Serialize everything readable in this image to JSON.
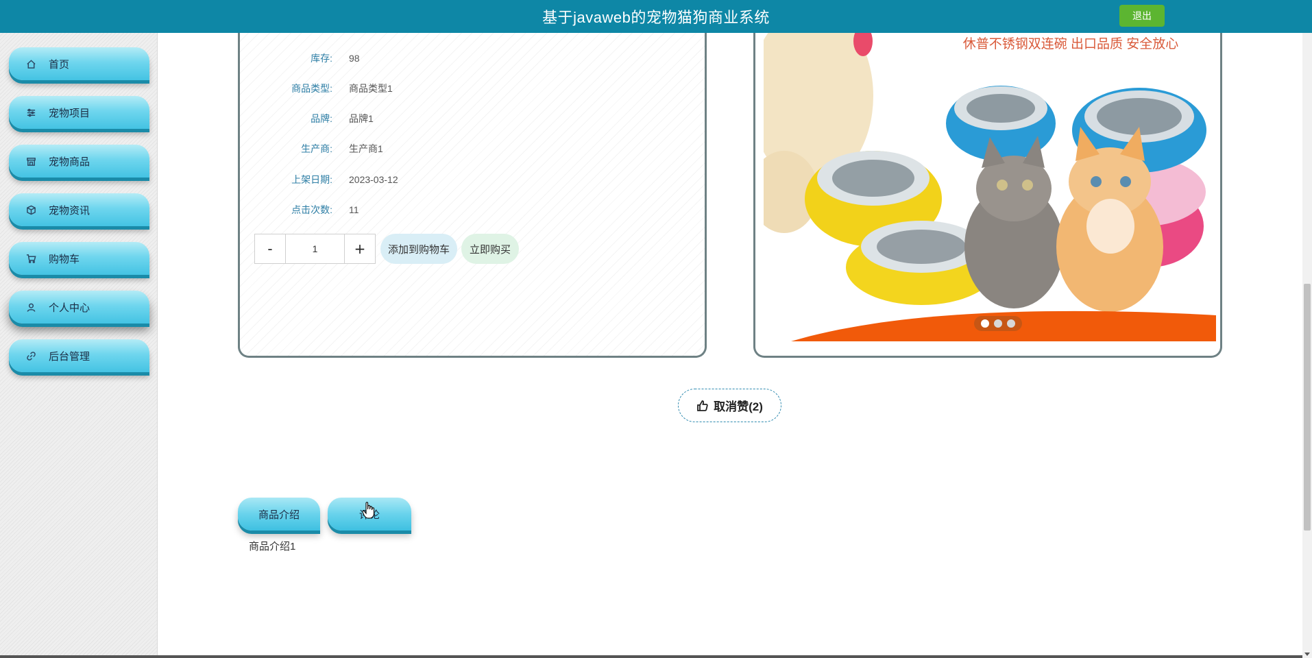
{
  "header": {
    "title": "基于javaweb的宠物猫狗商业系统",
    "logout_label": "退出",
    "bg_color": "#0e87a6",
    "logout_color": "#5cb531"
  },
  "sidebar": {
    "items": [
      {
        "label": "首页",
        "icon": "home-icon"
      },
      {
        "label": "宠物项目",
        "icon": "sliders-icon"
      },
      {
        "label": "宠物商品",
        "icon": "shop-icon"
      },
      {
        "label": "宠物资讯",
        "icon": "cube-icon"
      },
      {
        "label": "购物车",
        "icon": "cart-icon"
      },
      {
        "label": "个人中心",
        "icon": "user-icon"
      },
      {
        "label": "后台管理",
        "icon": "link-icon"
      }
    ],
    "active": "个人中心"
  },
  "product": {
    "fields": [
      {
        "label": "库存:",
        "value": "98"
      },
      {
        "label": "商品类型:",
        "value": "商品类型1"
      },
      {
        "label": "品牌:",
        "value": "品牌1"
      },
      {
        "label": "生产商:",
        "value": "生产商1"
      },
      {
        "label": "上架日期:",
        "value": "2023-03-12"
      },
      {
        "label": "点击次数:",
        "value": "11"
      }
    ],
    "quantity": {
      "minus": "-",
      "value": "1",
      "plus": "+"
    },
    "add_to_cart_label": "添加到购物车",
    "buy_now_label": "立即购买"
  },
  "carousel": {
    "slogan": "休普不锈钢双连碗 出口品质 安全放心",
    "dots": 3,
    "active_dot": 0
  },
  "like": {
    "label": "取消赞(2)",
    "icon": "thumbs-up-icon"
  },
  "tabs": {
    "items": [
      "商品介绍",
      "评论"
    ],
    "active_content": "商品介绍1"
  }
}
